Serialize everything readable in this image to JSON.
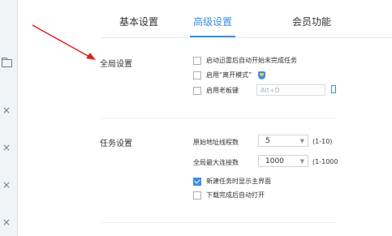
{
  "tabs": [
    {
      "label": "基本设置",
      "active": false
    },
    {
      "label": "高级设置",
      "active": true
    },
    {
      "label": "会员功能",
      "active": false
    }
  ],
  "sidebar": {
    "icons": [
      "folder-icon",
      "close-icon",
      "close-icon",
      "close-icon",
      "close-icon",
      "close-icon"
    ],
    "close_glyph": "×"
  },
  "global_settings": {
    "title": "全局设置",
    "options": [
      {
        "label": "启动迅雷后自动开始未完成任务",
        "checked": false
      },
      {
        "label": "启用“离开模式”",
        "checked": false
      },
      {
        "label": "启用老板键",
        "checked": false
      }
    ],
    "hotkey_placeholder": "Alt+D"
  },
  "task_settings": {
    "title": "任务设置",
    "original_threads": {
      "label": "原始地址线程数",
      "value": "5",
      "range": "(1-10)"
    },
    "global_max_connections": {
      "label": "全局最大连接数",
      "value": "1000",
      "range": "(1-1000"
    },
    "options": [
      {
        "label": "新建任务时显示主界面",
        "checked": true
      },
      {
        "label": "下载完成后自动打开",
        "checked": false
      }
    ]
  },
  "colors": {
    "accent": "#3b8fe3",
    "annotation_arrow": "#e02020"
  }
}
